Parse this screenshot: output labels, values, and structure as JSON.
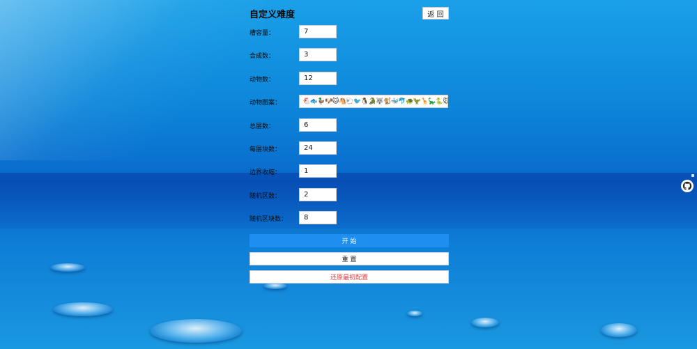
{
  "header": {
    "title": "自定义难度",
    "back_label": "返 回"
  },
  "fields": [
    {
      "label": "槽容量：",
      "value": "7"
    },
    {
      "label": "合成数：",
      "value": "3"
    },
    {
      "label": "动物数：",
      "value": "12"
    },
    {
      "label": "动物图案：",
      "value": "🐔🐟🦆🐶🐱🐴🐑🐦🐧🐊🐺🐒🐳🐬🐢🦖🦒🦕🐍🐭🐂"
    },
    {
      "label": "总层数：",
      "value": "6"
    },
    {
      "label": "每层块数：",
      "value": "24"
    },
    {
      "label": "边界收缩：",
      "value": "1"
    },
    {
      "label": "随机区数：",
      "value": "2"
    },
    {
      "label": "随机区块数：",
      "value": "8"
    }
  ],
  "buttons": {
    "start": "开 始",
    "reset": "重 置",
    "restore": "还原最初配置"
  },
  "colors": {
    "primary": "#1e8ef0",
    "danger": "#e23b3b"
  },
  "icons": {
    "edge_widget": "octocat-icon"
  }
}
